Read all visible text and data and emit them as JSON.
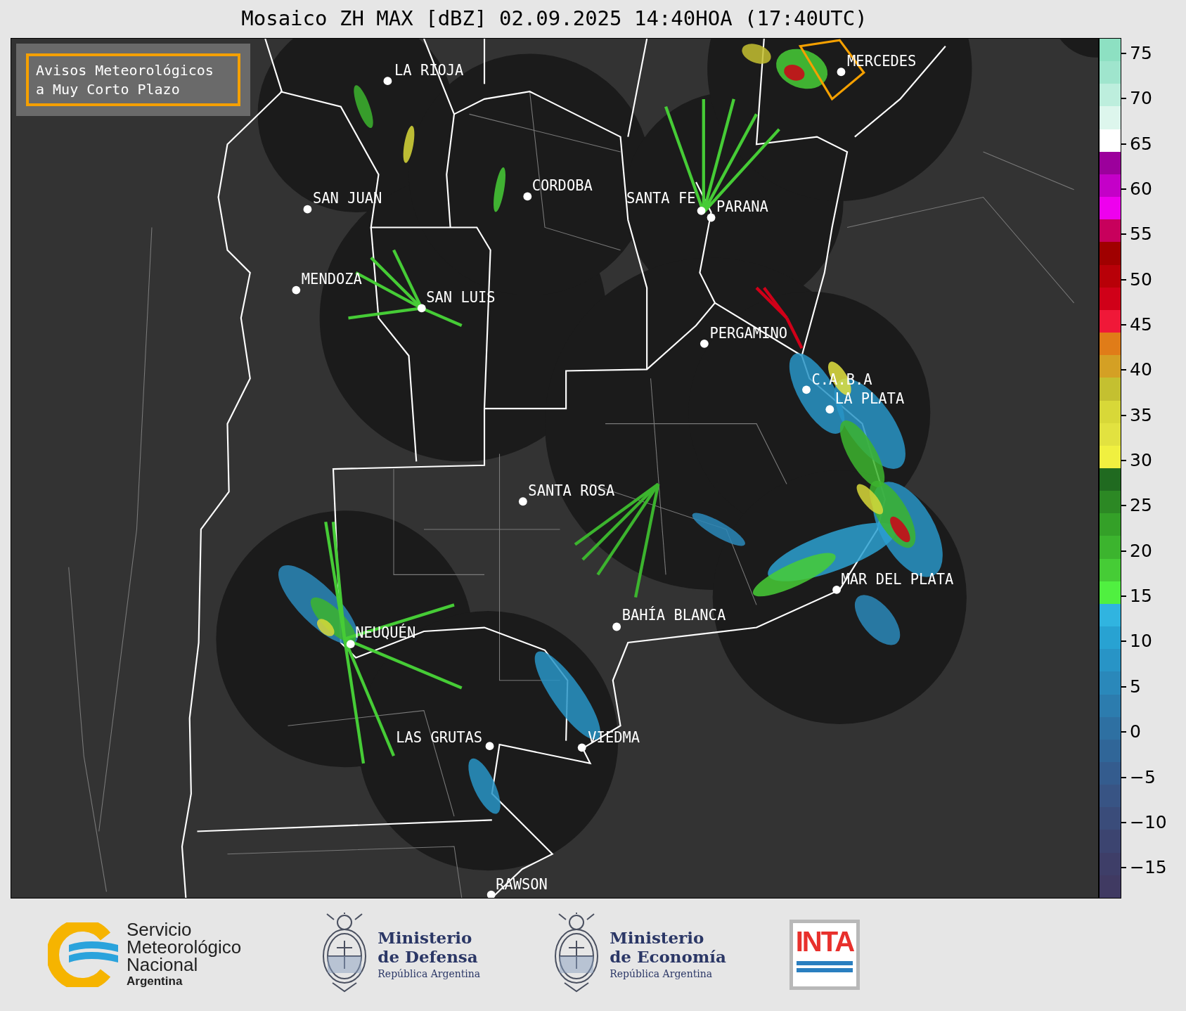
{
  "title": "Mosaico ZH MAX [dBZ] 02.09.2025 14:40HOA (17:40UTC)",
  "warning_box": {
    "lines": [
      "Avisos Meteorológicos",
      "a Muy Corto Plazo"
    ]
  },
  "map": {
    "cities": [
      {
        "name": "LA RIOJA"
      },
      {
        "name": "MERCEDES"
      },
      {
        "name": "CORDOBA"
      },
      {
        "name": "SAN JUAN"
      },
      {
        "name": "SANTA FE"
      },
      {
        "name": "PARANA"
      },
      {
        "name": "MENDOZA"
      },
      {
        "name": "SAN LUIS"
      },
      {
        "name": "PERGAMINO"
      },
      {
        "name": "C.A.B.A"
      },
      {
        "name": "LA PLATA"
      },
      {
        "name": "SANTA ROSA"
      },
      {
        "name": "MAR DEL PLATA"
      },
      {
        "name": "BAHÍA BLANCA"
      },
      {
        "name": "NEUQUÉN"
      },
      {
        "name": "LAS GRUTAS"
      },
      {
        "name": "VIEDMA"
      },
      {
        "name": "RAWSON"
      }
    ]
  },
  "colorbar": {
    "ticks": [
      "75",
      "70",
      "65",
      "60",
      "55",
      "50",
      "45",
      "40",
      "35",
      "30",
      "25",
      "20",
      "15",
      "10",
      "5",
      "0",
      "−5",
      "−10",
      "−15"
    ],
    "segments": [
      {
        "color": "#8de0c2"
      },
      {
        "color": "#9fe5cd"
      },
      {
        "color": "#bdeedd"
      },
      {
        "color": "#ddf6ed"
      },
      {
        "color": "#ffffff"
      },
      {
        "color": "#9c009c"
      },
      {
        "color": "#c400c8"
      },
      {
        "color": "#ee00ee"
      },
      {
        "color": "#c8005c"
      },
      {
        "color": "#a00000"
      },
      {
        "color": "#b80008"
      },
      {
        "color": "#d00018"
      },
      {
        "color": "#f01838"
      },
      {
        "color": "#e07c18"
      },
      {
        "color": "#d4a024"
      },
      {
        "color": "#c4c030"
      },
      {
        "color": "#d8d838"
      },
      {
        "color": "#e2e240"
      },
      {
        "color": "#f0f040"
      },
      {
        "color": "#206a20"
      },
      {
        "color": "#2c8824"
      },
      {
        "color": "#34a028"
      },
      {
        "color": "#3cb42e"
      },
      {
        "color": "#46cc36"
      },
      {
        "color": "#50f040"
      },
      {
        "color": "#30b4e0"
      },
      {
        "color": "#28a2d2"
      },
      {
        "color": "#2894c6"
      },
      {
        "color": "#2a88ba"
      },
      {
        "color": "#2c7cae"
      },
      {
        "color": "#2e70a2"
      },
      {
        "color": "#306698"
      },
      {
        "color": "#345c8e"
      },
      {
        "color": "#385484"
      },
      {
        "color": "#3a4c7a"
      },
      {
        "color": "#3c4470"
      },
      {
        "color": "#3e3e68"
      },
      {
        "color": "#403a62"
      }
    ]
  },
  "logos": [
    {
      "kind": "smn",
      "lines": [
        "Servicio",
        "Meteorológico",
        "Nacional"
      ],
      "country": "Argentina"
    },
    {
      "kind": "ministry",
      "lines": [
        "Ministerio",
        "de Defensa"
      ],
      "subtitle": "República Argentina"
    },
    {
      "kind": "ministry",
      "lines": [
        "Ministerio",
        "de Economía"
      ],
      "subtitle": "República Argentina"
    },
    {
      "kind": "inta",
      "text": "INTA"
    }
  ]
}
